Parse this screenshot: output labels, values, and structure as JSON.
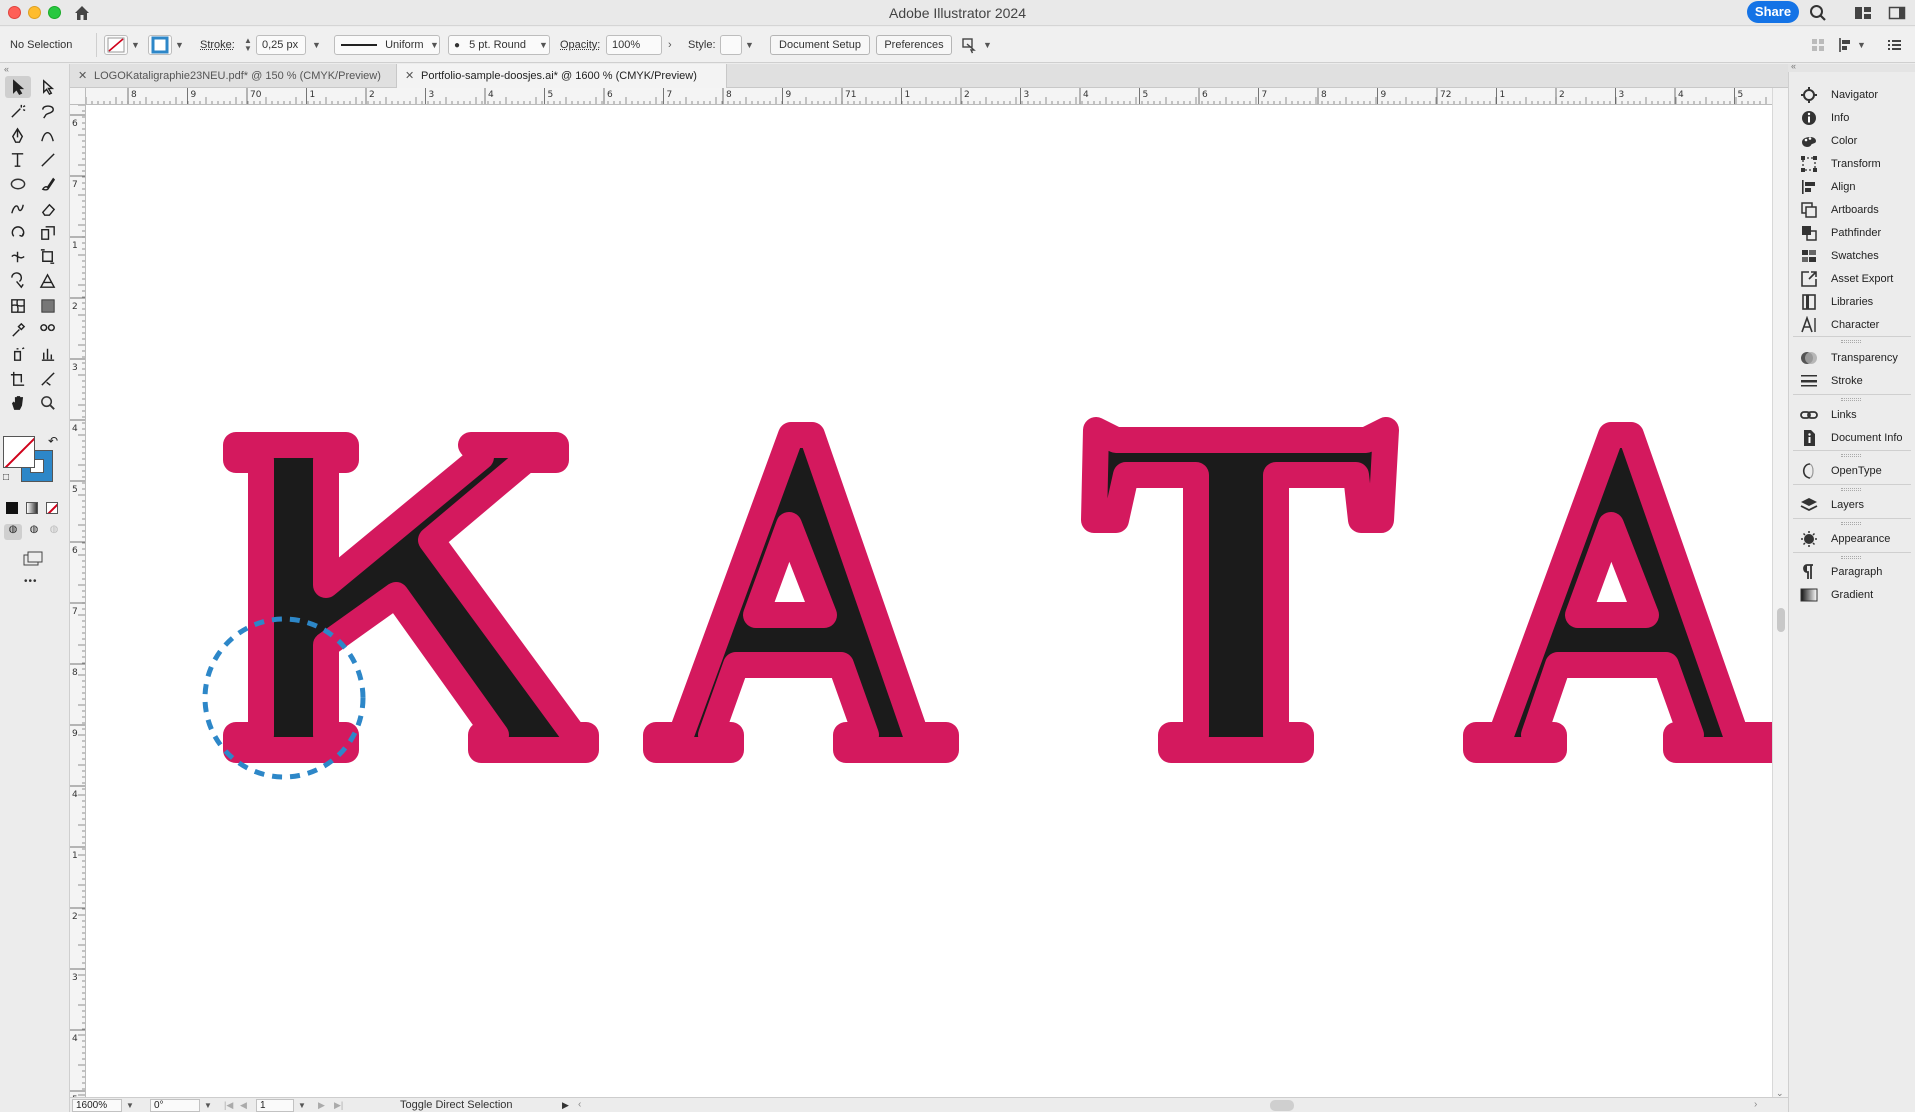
{
  "window": {
    "title": "Adobe Illustrator 2024",
    "share_label": "Share"
  },
  "controlbar": {
    "selection": "No Selection",
    "stroke_label": "Stroke:",
    "stroke_value": "0,25 px",
    "profile": "Uniform",
    "brush": "5 pt. Round",
    "opacity_label": "Opacity:",
    "opacity_value": "100%",
    "style_label": "Style:",
    "document_setup": "Document Setup",
    "preferences": "Preferences"
  },
  "tabs": [
    {
      "label": "LOGOKataligraphie23NEU.pdf* @ 150 % (CMYK/Preview)",
      "active": false
    },
    {
      "label": "Portfolio-sample-doosjes.ai* @ 1600 % (CMYK/Preview)",
      "active": true
    }
  ],
  "ruler": {
    "h_labels": [
      "8",
      "9",
      "70",
      "1",
      "2",
      "3",
      "4",
      "5",
      "6",
      "7",
      "8",
      "9",
      "71",
      "1",
      "2",
      "3",
      "4",
      "5",
      "6",
      "7",
      "8",
      "9",
      "72",
      "1",
      "2",
      "3",
      "4",
      "5"
    ],
    "v_labels": [
      "6",
      "7",
      "1",
      "2",
      "3",
      "4",
      "5",
      "6",
      "7",
      "8",
      "9",
      "4",
      "1",
      "2",
      "3",
      "4",
      "5"
    ]
  },
  "artwork": {
    "letters": [
      "K",
      "A",
      "T",
      "A"
    ],
    "fill_color": "#1b1b1b",
    "outline_color": "#d4195e",
    "cursor_color": "#2d87c8"
  },
  "statusbar": {
    "zoom": "1600%",
    "rotation": "0°",
    "artboard": "1",
    "status_text": "Toggle Direct Selection"
  },
  "panels": [
    {
      "label": "Navigator",
      "icon": "navigator-icon"
    },
    {
      "label": "Info",
      "icon": "info-icon"
    },
    {
      "label": "Color",
      "icon": "color-icon"
    },
    {
      "label": "Transform",
      "icon": "transform-icon"
    },
    {
      "label": "Align",
      "icon": "align-icon"
    },
    {
      "label": "Artboards",
      "icon": "artboards-icon"
    },
    {
      "label": "Pathfinder",
      "icon": "pathfinder-icon"
    },
    {
      "label": "Swatches",
      "icon": "swatches-icon"
    },
    {
      "label": "Asset Export",
      "icon": "asset-export-icon"
    },
    {
      "label": "Libraries",
      "icon": "libraries-icon"
    },
    {
      "label": "Character",
      "icon": "character-icon"
    },
    {
      "label": "Transparency",
      "icon": "transparency-icon"
    },
    {
      "label": "Stroke",
      "icon": "stroke-icon"
    },
    {
      "label": "Links",
      "icon": "links-icon"
    },
    {
      "label": "Document Info",
      "icon": "document-info-icon"
    },
    {
      "label": "OpenType",
      "icon": "opentype-icon"
    },
    {
      "label": "Layers",
      "icon": "layers-icon"
    },
    {
      "label": "Appearance",
      "icon": "appearance-icon"
    },
    {
      "label": "Paragraph",
      "icon": "paragraph-icon"
    },
    {
      "label": "Gradient",
      "icon": "gradient-icon"
    }
  ],
  "colors": {
    "accent": "#1473e6",
    "selection_blue": "#2d87c8"
  }
}
